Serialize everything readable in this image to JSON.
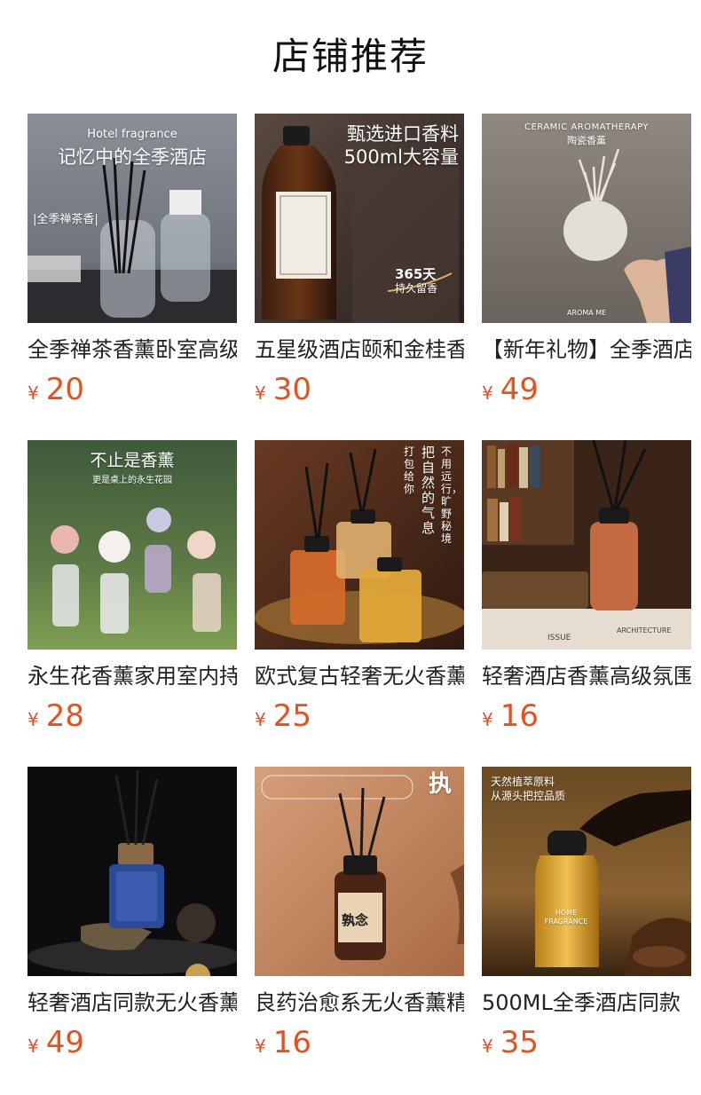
{
  "page": {
    "title": "店铺推荐"
  },
  "currency": "¥",
  "products": [
    {
      "name": "全季禅茶香薰卧室高级",
      "price": "20",
      "overlay": {
        "line1": "Hotel fragrance",
        "line2": "记忆中的全季酒店",
        "tag": "|全季禅茶香|"
      }
    },
    {
      "name": "五星级酒店颐和金桂香",
      "price": "30",
      "overlay": {
        "line1": "甄选进口香料",
        "line2": "500ml大容量",
        "line3": "365天",
        "line4": "持久留香"
      }
    },
    {
      "name": "【新年礼物】全季酒店",
      "price": "49",
      "overlay": {
        "line1": "CERAMIC AROMATHERAPY",
        "line2": "陶瓷香薰",
        "line3": "AROMA ME"
      }
    },
    {
      "name": "永生花香薰家用室内持",
      "price": "28",
      "overlay": {
        "line1": "不止是香薰",
        "line2": "更是桌上的永生花园"
      }
    },
    {
      "name": "欧式复古轻奢无火香薰",
      "price": "25",
      "overlay": {
        "line1": "打包给你",
        "line2": "把自然的气息",
        "line3": "不用远行，旷野秘境"
      }
    },
    {
      "name": "轻奢酒店香薰高级氛围",
      "price": "16",
      "overlay": {
        "line1": "ISSUE",
        "line2": "ARCHITECTURE"
      }
    },
    {
      "name": "轻奢酒店同款无火香薰",
      "price": "49",
      "overlay": {}
    },
    {
      "name": "良药治愈系无火香薰精",
      "price": "16",
      "overlay": {
        "line1": "执",
        "line2": "孰念"
      }
    },
    {
      "name": "500ML全季酒店同款",
      "price": "35",
      "overlay": {
        "line1": "天然植萃原料",
        "line2": "从源头把控品质",
        "line3": "HOME FRAGRANCE"
      }
    }
  ],
  "colors": {
    "accent": "#e8501c",
    "title": "#111111"
  }
}
